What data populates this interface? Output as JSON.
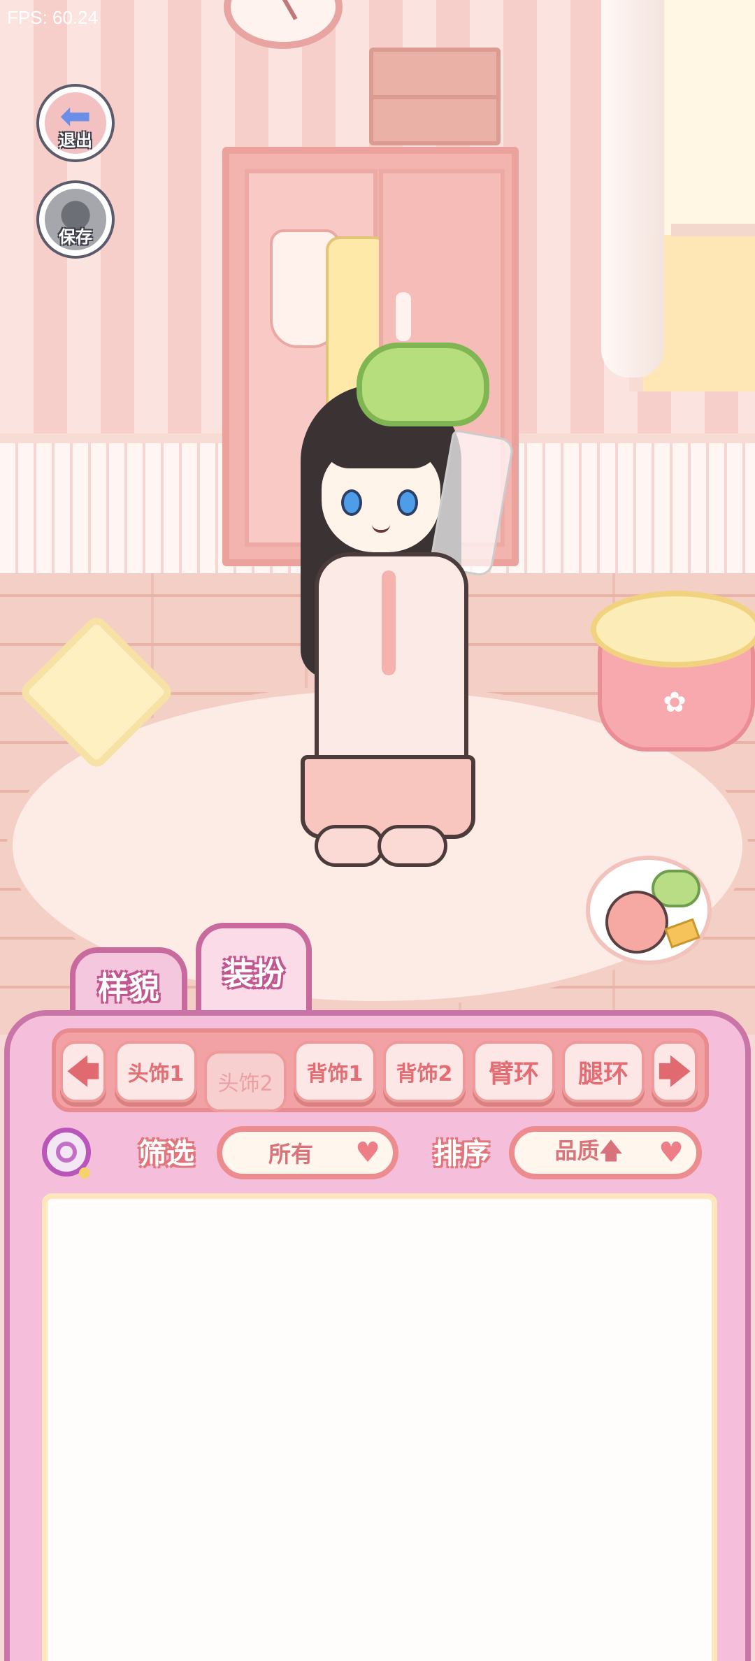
{
  "fps": "FPS: 60.24",
  "side_buttons": {
    "exit_label": "退出",
    "save_label": "保存"
  },
  "tabs": [
    {
      "label": "样貌",
      "selected": false
    },
    {
      "label": "装扮",
      "selected": true
    }
  ],
  "categories": {
    "prev_icon": "arrow-left-icon",
    "next_icon": "arrow-right-icon",
    "items": [
      {
        "label": "头饰1",
        "selected": false
      },
      {
        "label": "头饰2",
        "selected": true
      },
      {
        "label": "背饰1",
        "selected": false
      },
      {
        "label": "背饰2",
        "selected": false
      },
      {
        "label": "臂环",
        "selected": false
      },
      {
        "label": "腿环",
        "selected": false
      }
    ]
  },
  "filter": {
    "label": "筛选",
    "value": "所有"
  },
  "sort": {
    "label": "排序",
    "value": "品质",
    "direction_icon": "arrow-up-icon"
  },
  "colors": {
    "panel_bg": "#f5bfdc",
    "panel_border": "#c975a7",
    "category_bar": "#f2a1a4",
    "accent_text": "#e26d72"
  }
}
